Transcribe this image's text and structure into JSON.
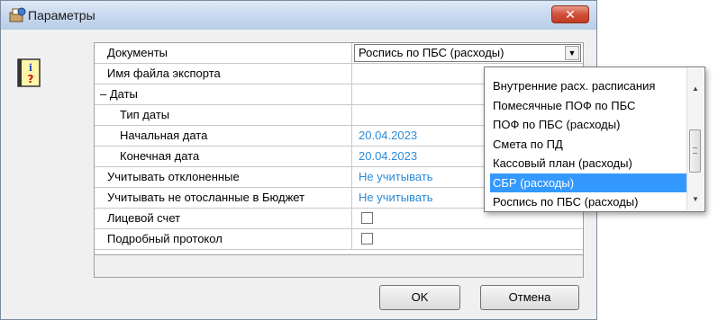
{
  "window": {
    "title": "Параметры",
    "close_label": "✕"
  },
  "grid": {
    "rows": [
      {
        "name": "Документы",
        "value": "Роспись по ПБС (расходы)"
      },
      {
        "name": "Имя файла экспорта",
        "value": ""
      },
      {
        "name": "Даты",
        "expander": "–"
      },
      {
        "name": "Тип даты",
        "value": ""
      },
      {
        "name": "Начальная дата",
        "value": "20.04.2023"
      },
      {
        "name": "Конечная дата",
        "value": "20.04.2023"
      },
      {
        "name": "Учитывать отклоненные",
        "value": "Не учитывать"
      },
      {
        "name": "Учитывать не отосланные в Бюджет",
        "value": "Не учитывать"
      },
      {
        "name": "Лицевой счет",
        "checked": false
      },
      {
        "name": "Подробный протокол",
        "checked": false
      }
    ]
  },
  "dropdown": {
    "items": [
      "Внутренние расх. расписания",
      "Помесячные ПОФ по ПБС",
      "ПОФ по ПБС (расходы)",
      "Смета по ПД",
      "Кассовый план (расходы)",
      "СБР (расходы)",
      "Роспись по ПБС (расходы)"
    ],
    "selected_index": 5
  },
  "buttons": {
    "ok": "OK",
    "cancel": "Отмена"
  },
  "colors": {
    "value_text": "#2d8ad8",
    "selection": "#3399ff"
  },
  "icons": {
    "title": "params-icon",
    "info": "info-book-icon",
    "dropdown_scroll": [
      "arrow-up-icon",
      "arrow-down-icon"
    ]
  }
}
